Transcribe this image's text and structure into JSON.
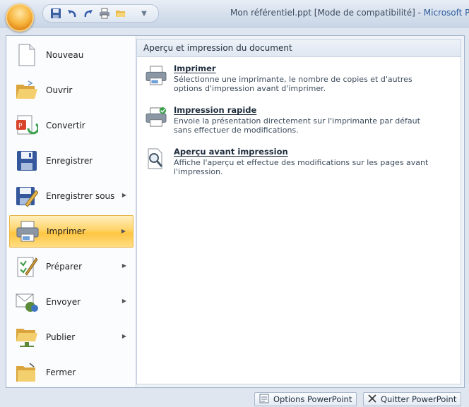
{
  "window": {
    "doc_title": "Mon référentiel.ppt [Mode de compatibilité] - ",
    "app_name": "Microsoft Po"
  },
  "quick_access": [
    "save-icon",
    "undo-icon",
    "redo-icon",
    "print-icon",
    "open-icon"
  ],
  "menu_items": [
    {
      "label": "Nouveau",
      "icon": "new-document-icon",
      "submenu": false
    },
    {
      "label": "Ouvrir",
      "icon": "open-folder-icon",
      "submenu": false
    },
    {
      "label": "Convertir",
      "icon": "convert-icon",
      "submenu": false
    },
    {
      "label": "Enregistrer",
      "icon": "save-icon",
      "submenu": false
    },
    {
      "label": "Enregistrer sous",
      "icon": "save-as-icon",
      "submenu": true
    },
    {
      "label": "Imprimer",
      "icon": "printer-icon",
      "submenu": true,
      "active": true
    },
    {
      "label": "Préparer",
      "icon": "prepare-icon",
      "submenu": true
    },
    {
      "label": "Envoyer",
      "icon": "send-icon",
      "submenu": true
    },
    {
      "label": "Publier",
      "icon": "publish-icon",
      "submenu": true
    },
    {
      "label": "Fermer",
      "icon": "close-folder-icon",
      "submenu": false
    }
  ],
  "panel": {
    "heading": "Aperçu et impression du document",
    "options": [
      {
        "title": "Imprimer",
        "desc": "Sélectionne une imprimante, le nombre de copies et d'autres\noptions d'impression avant d'imprimer.",
        "icon": "printer-icon"
      },
      {
        "title": "Impression rapide",
        "desc": "Envoie la présentation directement sur l'imprimante par défaut\nsans effectuer de modifications.",
        "icon": "quick-print-icon"
      },
      {
        "title": "Aperçu avant impression",
        "desc": "Affiche l'aperçu et effectue des modifications sur les pages avant\nl'impression.",
        "icon": "print-preview-icon"
      }
    ]
  },
  "bottom_buttons": {
    "options": "Options PowerPoint",
    "quit": "Quitter PowerPoint"
  }
}
